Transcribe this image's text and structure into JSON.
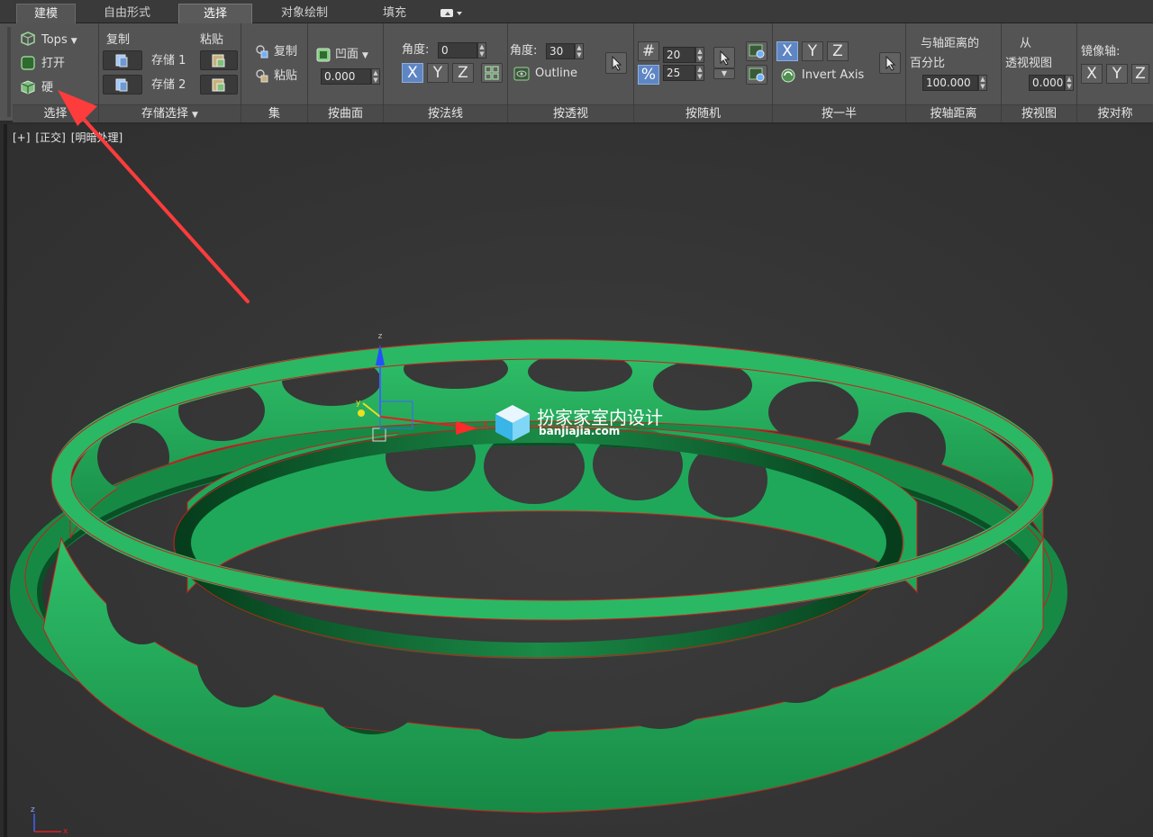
{
  "tabs": [
    "建模",
    "自由形式",
    "选择",
    "对象绘制",
    "填充"
  ],
  "select_panel": {
    "items": [
      "Tops",
      "打开",
      "硬"
    ],
    "footer": "选择"
  },
  "store_panel": {
    "copy_label": "复制",
    "paste_label": "粘贴",
    "store1": "存储 1",
    "store2": "存储 2",
    "footer": "存储选择"
  },
  "set_panel": {
    "copy": "复制",
    "paste": "粘贴",
    "footer": "集"
  },
  "surface_panel": {
    "mode": "凹面",
    "value": "0.000",
    "footer": "按曲面"
  },
  "normal_panel": {
    "angle_label": "角度:",
    "angle_value": "0",
    "axes": [
      "X",
      "Y",
      "Z"
    ],
    "footer": "按法线"
  },
  "persp_panel": {
    "angle_label": "角度:",
    "angle_value": "30",
    "outline": "Outline",
    "footer": "按透视"
  },
  "random_panel": {
    "count_value": "20",
    "percent_value": "25",
    "hash_symbol": "#",
    "percent_symbol": "%",
    "footer": "按随机"
  },
  "half_panel": {
    "axes": [
      "X",
      "Y",
      "Z"
    ],
    "invert": "Invert Axis",
    "footer": "按一半"
  },
  "axisdist_panel": {
    "line1": "与轴距离的",
    "line2": "百分比",
    "value": "100.000",
    "footer": "按轴距离"
  },
  "view_panel": {
    "line1": "从",
    "line2": "透视视图",
    "value": "0.000",
    "footer": "按视图"
  },
  "mirror_panel": {
    "label": "镜像轴:",
    "axes": [
      "X",
      "Y",
      "Z"
    ],
    "footer": "按对称"
  },
  "viewport": {
    "labels": [
      "[+]",
      "[正交]",
      "[明暗处理]"
    ]
  },
  "watermark": {
    "title": "扮家家室内设计",
    "site": "banjiajia.com"
  },
  "colors": {
    "object": "#1fa85a",
    "edge": "#c81e1e",
    "arrow": "#ff3c3c"
  }
}
